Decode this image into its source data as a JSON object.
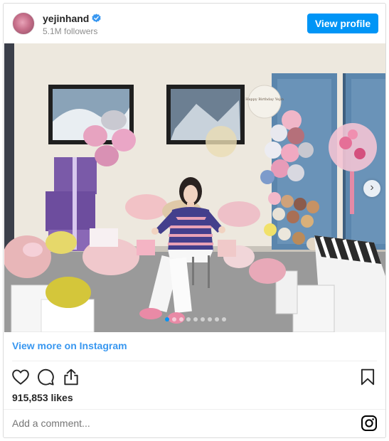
{
  "post": {
    "username": "yejinhand",
    "followers": "5.1M followers",
    "view_profile_label": "View profile",
    "view_more_label": "View more on Instagram",
    "likes": "915,853 likes",
    "comment_placeholder": "Add a comment...",
    "balloon_text": "Happy Birthday Yejin"
  },
  "carousel": {
    "total": 9,
    "active_index": 0
  },
  "colors": {
    "accent": "#0095f6",
    "link": "#3897f0",
    "verified": "#3897f0"
  },
  "icons": [
    "verified-badge-icon",
    "heart-icon",
    "comment-icon",
    "share-icon",
    "bookmark-icon",
    "instagram-logo-icon",
    "chevron-right-icon"
  ]
}
